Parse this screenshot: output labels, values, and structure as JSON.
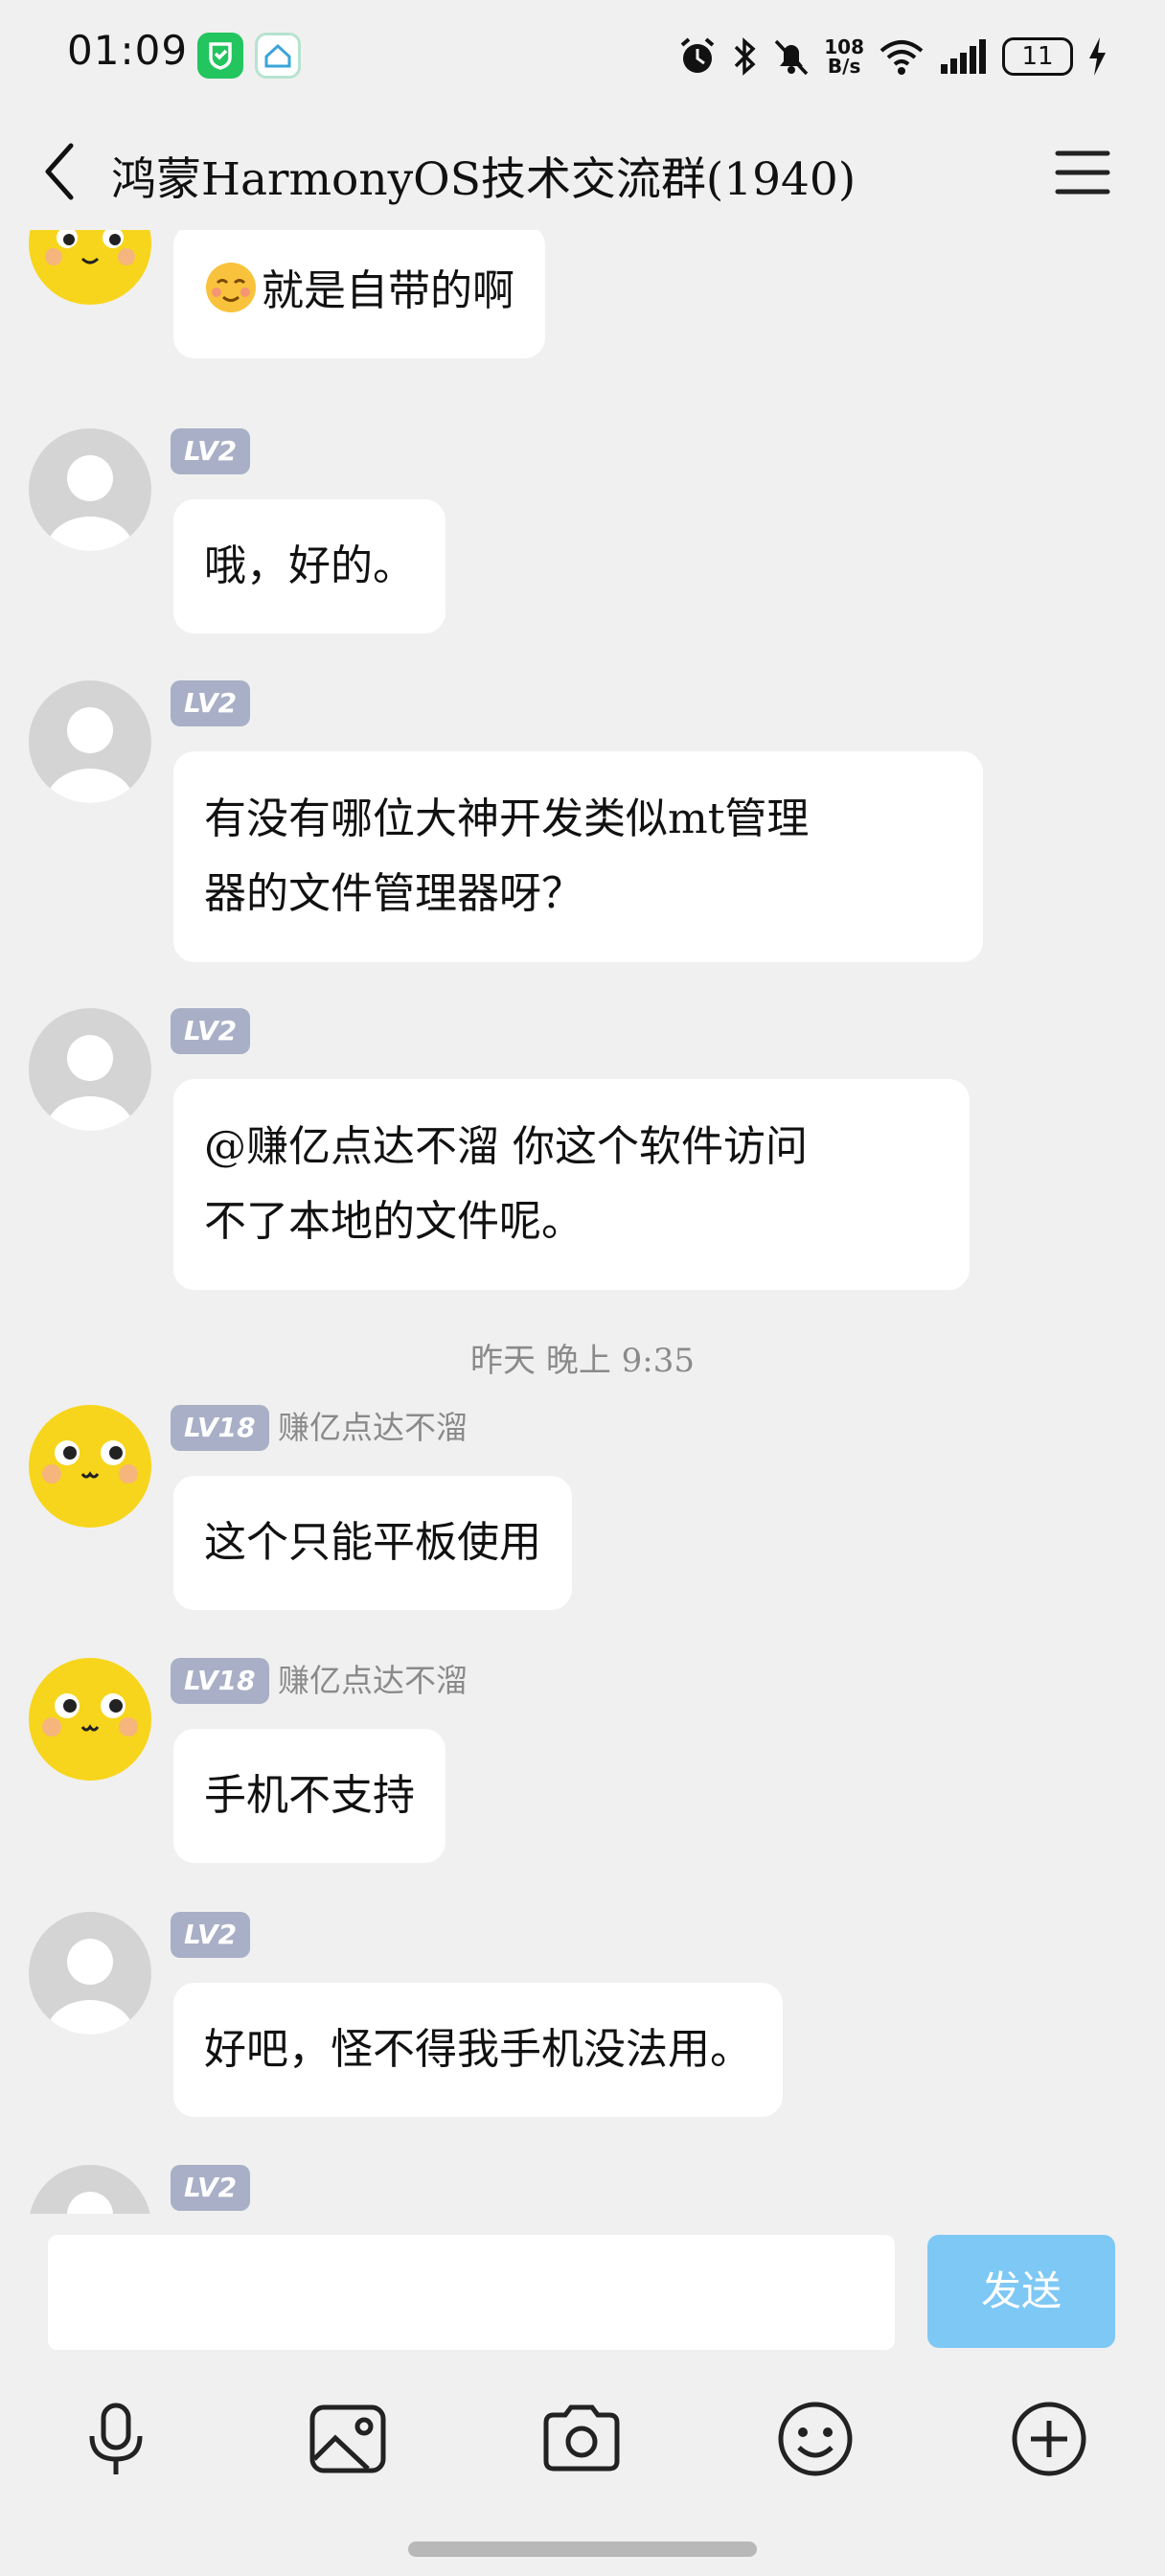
{
  "status_bar": {
    "time": "01:09",
    "net_speed_value": "108",
    "net_speed_unit": "B/s",
    "battery": "11"
  },
  "header": {
    "title": "鸿蒙HarmonyOS技术交流群(1940)"
  },
  "messages": [
    {
      "level": "",
      "sender": "",
      "text": "就是自带的啊",
      "emoji_prefix": "smiling-face"
    },
    {
      "level": "LV2",
      "sender": "",
      "text": "哦，好的。"
    },
    {
      "level": "LV2",
      "sender": "",
      "line1": "有没有哪位大神开发类似mt管理",
      "line2": "器的文件管理器呀？"
    },
    {
      "level": "LV2",
      "sender": "",
      "line1": "@赚亿点达不溜 你这个软件访问",
      "line2": "不了本地的文件呢。"
    },
    {
      "level": "LV18",
      "sender": "赚亿点达不溜",
      "text": "这个只能平板使用"
    },
    {
      "level": "LV18",
      "sender": "赚亿点达不溜",
      "text": "手机不支持"
    },
    {
      "level": "LV2",
      "sender": "",
      "text": "好吧，怪不得我手机没法用。"
    },
    {
      "level": "LV2",
      "sender": "",
      "text": ""
    }
  ],
  "time_divider": "昨天 晚上 9:35",
  "composer": {
    "input_value": "",
    "send_label": "发送"
  },
  "toolbar": {
    "icons": [
      "microphone-icon",
      "image-icon",
      "camera-icon",
      "emoji-icon",
      "plus-icon"
    ]
  },
  "colors": {
    "background": "#f0f0f0",
    "send_button": "#7ec8f5",
    "level_badge": "#a8afc6"
  }
}
